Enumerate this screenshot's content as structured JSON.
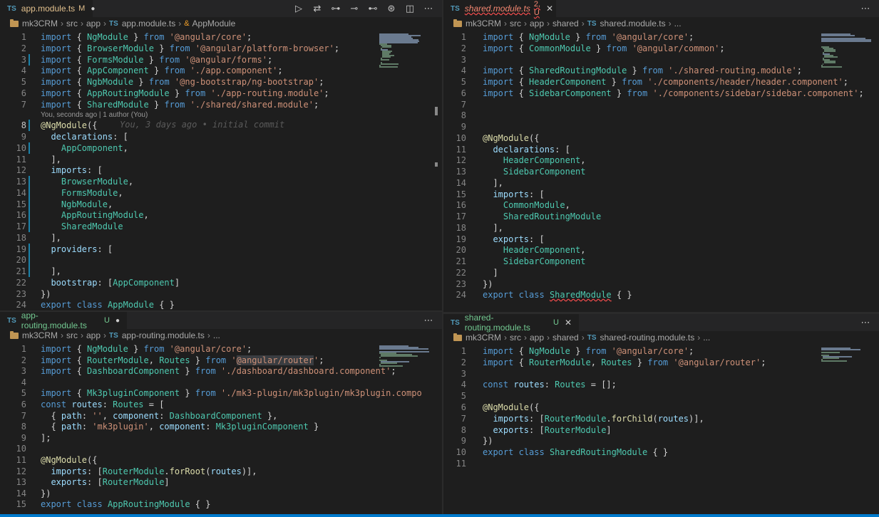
{
  "panes": {
    "top_left": {
      "tab": {
        "name": "app.module.ts",
        "status": "M",
        "badge": "TS"
      },
      "actions": [
        "run-icon",
        "compare-icon",
        "source-control-icon",
        "prev-change-icon",
        "next-change-icon",
        "git-graph-icon",
        "split-editor-icon",
        "more-icon"
      ],
      "breadcrumb": [
        "mk3CRM",
        "src",
        "app",
        "app.module.ts",
        "AppModule"
      ],
      "codelens": "You, seconds ago | 1 author (You)",
      "blame": "You, 3 days ago • initial commit",
      "line_numbers": [
        "1",
        "2",
        "3",
        "4",
        "5",
        "6",
        "7",
        "8",
        "9",
        "10",
        "11",
        "12",
        "13",
        "14",
        "15",
        "16",
        "17",
        "18",
        "19",
        "20",
        "21",
        "22",
        "23",
        "24"
      ]
    },
    "top_right": {
      "tab": {
        "name": "shared.module.ts",
        "status": "2, U",
        "badge": "TS"
      },
      "breadcrumb": [
        "mk3CRM",
        "src",
        "app",
        "shared",
        "shared.module.ts",
        "..."
      ],
      "line_numbers": [
        "1",
        "2",
        "3",
        "4",
        "5",
        "6",
        "7",
        "8",
        "9",
        "10",
        "11",
        "12",
        "13",
        "14",
        "15",
        "16",
        "17",
        "18",
        "19",
        "20",
        "21",
        "22",
        "23",
        "24"
      ]
    },
    "bottom_left": {
      "tab": {
        "name": "app-routing.module.ts",
        "status": "U",
        "badge": "TS"
      },
      "breadcrumb": [
        "mk3CRM",
        "src",
        "app",
        "app-routing.module.ts",
        "..."
      ],
      "line_numbers": [
        "1",
        "2",
        "3",
        "4",
        "5",
        "6",
        "7",
        "8",
        "9",
        "10",
        "11",
        "12",
        "13",
        "14",
        "15"
      ]
    },
    "bottom_right": {
      "tab": {
        "name": "shared-routing.module.ts",
        "status": "U",
        "badge": "TS"
      },
      "breadcrumb": [
        "mk3CRM",
        "src",
        "app",
        "shared",
        "shared-routing.module.ts",
        "..."
      ],
      "line_numbers": [
        "1",
        "2",
        "3",
        "4",
        "5",
        "6",
        "7",
        "8",
        "9",
        "10",
        "11"
      ]
    }
  },
  "code": {
    "top_left": [
      "import { NgModule } from '@angular/core';",
      "import { BrowserModule } from '@angular/platform-browser';",
      "import { FormsModule } from '@angular/forms';",
      "import { AppComponent } from './app.component';",
      "import { NgbModule } from '@ng-bootstrap/ng-bootstrap';",
      "import { AppRoutingModule } from './app-routing.module';",
      "import { SharedModule } from './shared/shared.module';",
      "@NgModule({",
      "  declarations: [",
      "    AppComponent,",
      "  ],",
      "  imports: [",
      "    BrowserModule,",
      "    FormsModule,",
      "    NgbModule,",
      "    AppRoutingModule,",
      "    SharedModule",
      "  ],",
      "  providers: [",
      "",
      "  ],",
      "  bootstrap: [AppComponent]",
      "})",
      "export class AppModule { }"
    ],
    "top_right": [
      "import { NgModule } from '@angular/core';",
      "import { CommonModule } from '@angular/common';",
      "",
      "import { SharedRoutingModule } from './shared-routing.module';",
      "import { HeaderComponent } from './components/header/header.component';",
      "import { SidebarComponent } from './components/sidebar/sidebar.component';",
      "",
      "",
      "",
      "@NgModule({",
      "  declarations: [",
      "    HeaderComponent,",
      "    SidebarComponent",
      "  ],",
      "  imports: [",
      "    CommonModule,",
      "    SharedRoutingModule",
      "  ],",
      "  exports: [",
      "    HeaderComponent,",
      "    SidebarComponent",
      "  ]",
      "})",
      "export class SharedModule { }"
    ],
    "bottom_left": [
      "import { NgModule } from '@angular/core';",
      "import { RouterModule, Routes } from '@angular/router';",
      "import { DashboardComponent } from './dashboard/dashboard.component';",
      "",
      "import { Mk3pluginComponent } from './mk3-plugin/mk3plugin/mk3plugin.compo",
      "const routes: Routes = [",
      "  { path: '', component: DashboardComponent },",
      "  { path: 'mk3plugin', component: Mk3pluginComponent }",
      "];",
      "",
      "@NgModule({",
      "  imports: [RouterModule.forRoot(routes)],",
      "  exports: [RouterModule]",
      "})",
      "export class AppRoutingModule { }"
    ],
    "bottom_right": [
      "import { NgModule } from '@angular/core';",
      "import { RouterModule, Routes } from '@angular/router';",
      "",
      "const routes: Routes = [];",
      "",
      "@NgModule({",
      "  imports: [RouterModule.forChild(routes)],",
      "  exports: [RouterModule]",
      "})",
      "export class SharedRoutingModule { }",
      ""
    ]
  },
  "colors": {
    "keyword": "#569cd6",
    "string": "#ce9178",
    "class": "#4ec9b0",
    "variable": "#9cdcfe",
    "function": "#dcdcaa",
    "modified_gutter": "#1b81a8",
    "accent": "#007acc"
  }
}
